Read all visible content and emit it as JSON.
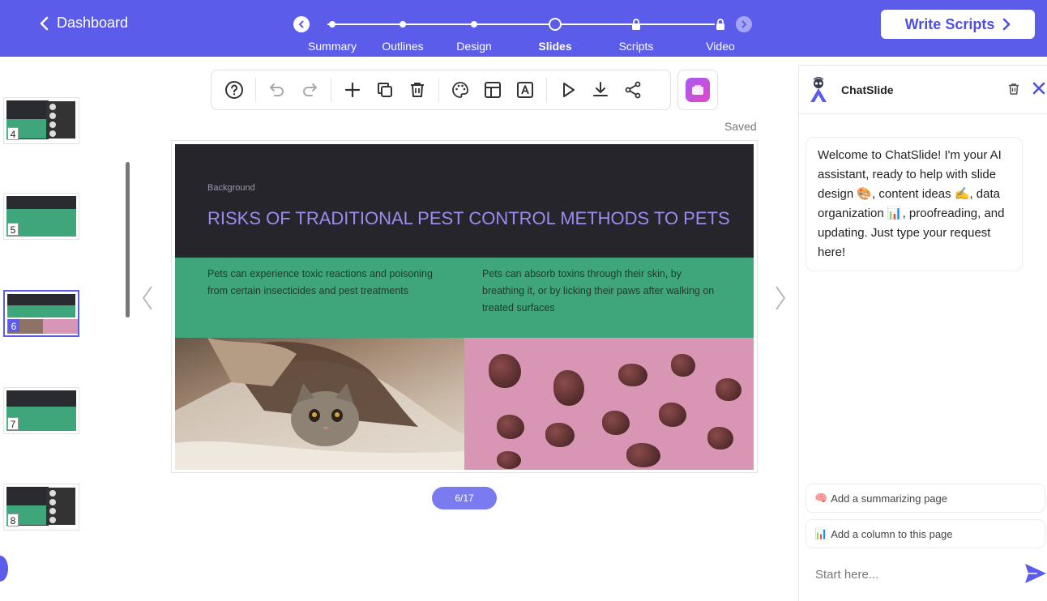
{
  "header": {
    "back_label": "Dashboard",
    "steps": [
      {
        "label": "Summary",
        "state": "done"
      },
      {
        "label": "Outlines",
        "state": "done"
      },
      {
        "label": "Design",
        "state": "done"
      },
      {
        "label": "Slides",
        "state": "current"
      },
      {
        "label": "Scripts",
        "state": "locked"
      },
      {
        "label": "Video",
        "state": "locked"
      }
    ],
    "write_scripts_label": "Write Scripts",
    "accent_color": "#5b5ce9"
  },
  "thumbnails": [
    {
      "number": "4",
      "style": "list"
    },
    {
      "number": "5",
      "style": "plain"
    },
    {
      "number": "6",
      "style": "images",
      "active": true
    },
    {
      "number": "7",
      "style": "plain"
    },
    {
      "number": "8",
      "style": "list"
    }
  ],
  "toolbar": {
    "icons": [
      "help-icon",
      "undo-icon",
      "redo-icon",
      "add-icon",
      "duplicate-icon",
      "trash-icon",
      "palette-icon",
      "layout-icon",
      "text-icon",
      "play-icon",
      "download-icon",
      "share-icon"
    ],
    "saved_label": "Saved"
  },
  "slide": {
    "subtitle": "Background",
    "title": "RISKS OF TRADITIONAL PEST CONTROL METHODS TO PETS",
    "col1": "Pets can experience toxic reactions and poisoning from certain insecticides and pest treatments",
    "col2": "Pets can absorb toxins through their skin, by breathing it, or by licking their paws after walking on treated surfaces",
    "page_indicator": "6/17",
    "colors": {
      "dark": "#25252b",
      "title": "#9c8cf0",
      "green": "#3fa57b",
      "pink": "#d996b4"
    }
  },
  "chat": {
    "name": "ChatSlide",
    "welcome": "Welcome to ChatSlide! I'm your AI assistant, ready to help with slide design 🎨, content ideas ✍️, data organization 📊, proofreading, and updating. Just type your request here!",
    "suggestions": [
      {
        "icon": "🧠",
        "label": "Add a summarizing page"
      },
      {
        "icon": "📊",
        "label": "Add a column to this page"
      }
    ],
    "input_placeholder": "Start here..."
  }
}
